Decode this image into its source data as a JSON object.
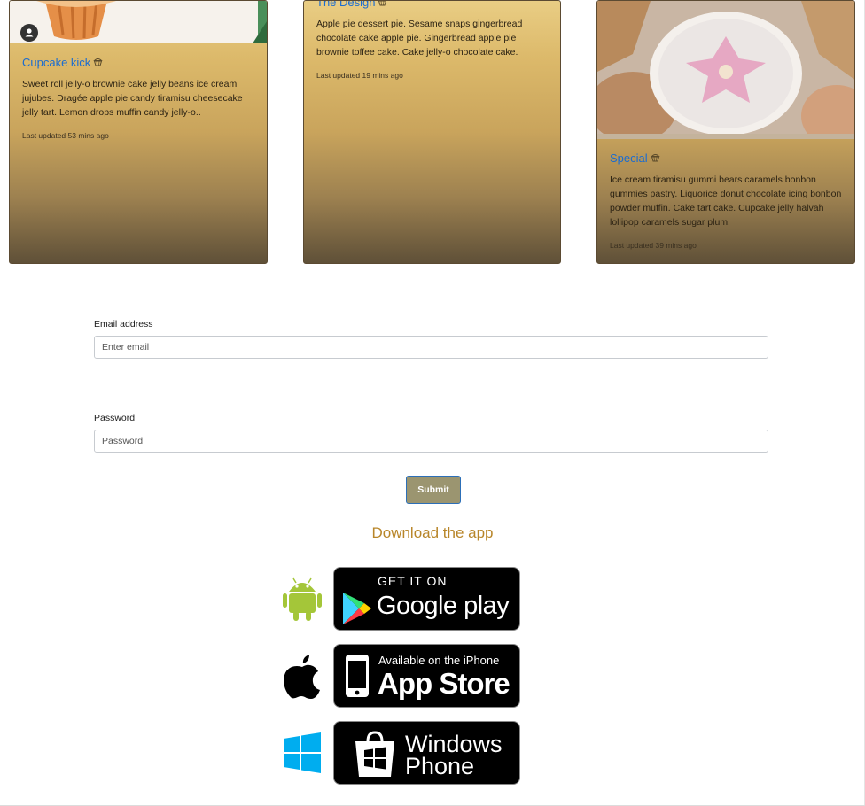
{
  "cards": [
    {
      "title": "Cupcake kick",
      "title_icon": "cupcake-icon",
      "text": "Sweet roll jelly-o brownie cake jelly beans ice cream jujubes. Dragée apple pie candy tiramisu cheesecake jelly tart. Lemon drops muffin candy jelly-o..",
      "updated": "Last updated 53 mins ago"
    },
    {
      "title": "The Design",
      "title_icon": "cupcake-icon",
      "text": "Apple pie dessert pie. Sesame snaps gingerbread chocolate cake apple pie. Gingerbread apple pie brownie toffee cake. Cake jelly-o chocolate cake.",
      "updated": "Last updated 19 mins ago"
    },
    {
      "title": "Special",
      "title_icon": "cupcake-icon",
      "text": "Ice cream tiramisu gummi bears caramels bonbon gummies pastry. Liquorice donut chocolate icing bonbon powder muffin. Cake tart cake. Cupcake jelly halvah lollipop caramels sugar plum.",
      "updated": "Last updated 39 mins ago"
    }
  ],
  "form": {
    "email_label": "Email address",
    "email_placeholder": "Enter email",
    "email_value": "",
    "password_label": "Password",
    "password_placeholder": "Password",
    "password_value": "",
    "submit_label": "Submit"
  },
  "download": {
    "title": "Download the app",
    "stores": [
      {
        "platform_icon": "android-icon",
        "line1": "GET IT ON",
        "line2": "Google play"
      },
      {
        "platform_icon": "apple-icon",
        "line1": "Available on the iPhone",
        "line2": "App Store"
      },
      {
        "platform_icon": "windows-icon",
        "line1": "Windows",
        "line2": "Phone"
      }
    ]
  },
  "colors": {
    "link": "#1a6cd1",
    "download_title": "#b8862a",
    "submit_bg": "#9b9570",
    "android": "#a4c639",
    "windows": "#00adef"
  }
}
